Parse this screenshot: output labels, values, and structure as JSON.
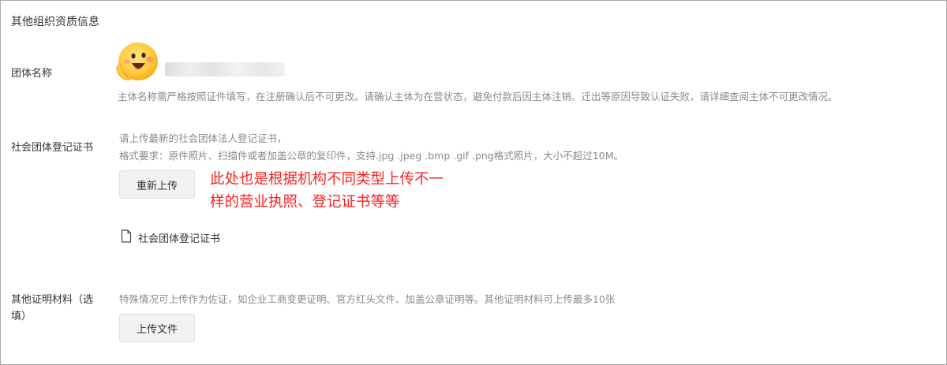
{
  "section": {
    "title": "其他组织资质信息"
  },
  "org_name": {
    "label": "团体名称",
    "hint": "主体名称需严格按照证件填写，在注册确认后不可更改。请确认主体为在营状态，避免付款后因主体注销、迁出等原因导致认证失败，请详细查阅主体不可更改情况。"
  },
  "certificate": {
    "label": "社会团体登记证书",
    "hint_line1": "请上传最新的社会团体法人登记证书，",
    "hint_line2": "格式要求：原件照片、扫描件或者加盖公章的复印件，支持.jpg .jpeg .bmp .gif .png格式照片，大小不超过10M。",
    "button_label": "重新上传",
    "file_name": "社会团体登记证书",
    "annotation_line1": "此处也是根据机构不同类型上传不一",
    "annotation_line2": "样的营业执照、登记证书等等"
  },
  "other_materials": {
    "label_line1": "其他证明材料（选",
    "label_line2": "填）",
    "hint": "特殊情况可上传作为佐证，如企业工商变更证明、官方红头文件、加盖公章证明等。其他证明材料可上传最多10张",
    "button_label": "上传文件"
  },
  "colors": {
    "annotation": "#ff1f1f",
    "hint": "#8a8a8a",
    "text": "#353535",
    "button_bg": "#f2f2f2"
  },
  "icons": {
    "avatar": "smiling-emoji-avatar",
    "file": "file-icon"
  }
}
